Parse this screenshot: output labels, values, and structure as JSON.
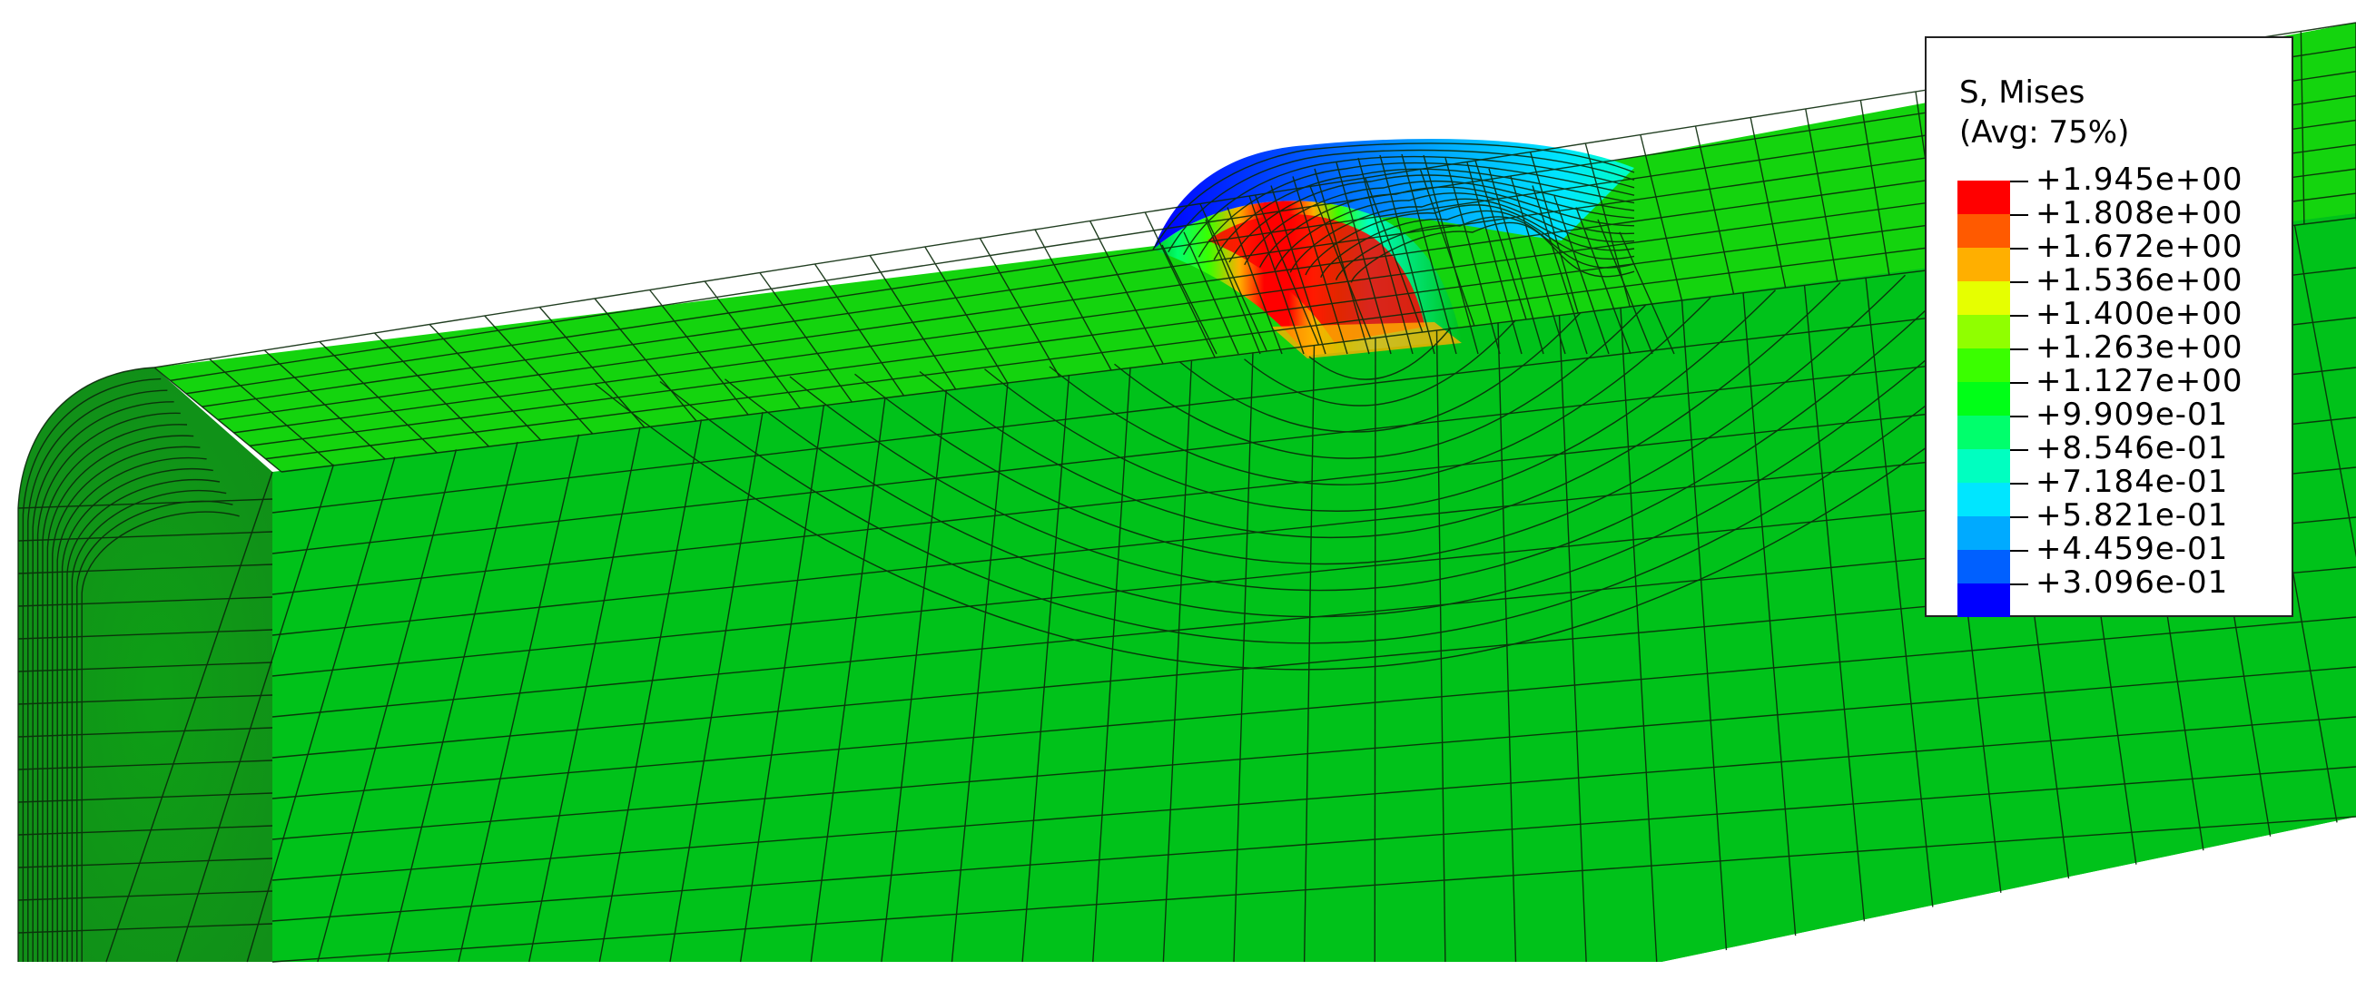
{
  "legend": {
    "title": "S, Mises",
    "subtitle": "(Avg: 75%)",
    "ticks": [
      "+1.945e+00",
      "+1.808e+00",
      "+1.672e+00",
      "+1.536e+00",
      "+1.400e+00",
      "+1.263e+00",
      "+1.127e+00",
      "+9.909e-01",
      "+8.546e-01",
      "+7.184e-01",
      "+5.821e-01",
      "+4.459e-01",
      "+3.096e-01"
    ],
    "bands": [
      "#ff0000",
      "#ff5a00",
      "#ffaf00",
      "#e6ff00",
      "#90ff00",
      "#3aff00",
      "#00ff17",
      "#00ff6c",
      "#00ffc0",
      "#00e6ff",
      "#00aaff",
      "#0060ff",
      "#0000ff"
    ]
  },
  "model": {
    "base_color": "#00c21a",
    "top_color": "#14d40e",
    "end_face_color": "#10b818",
    "mesh_line_color": "#0a2a0a"
  }
}
